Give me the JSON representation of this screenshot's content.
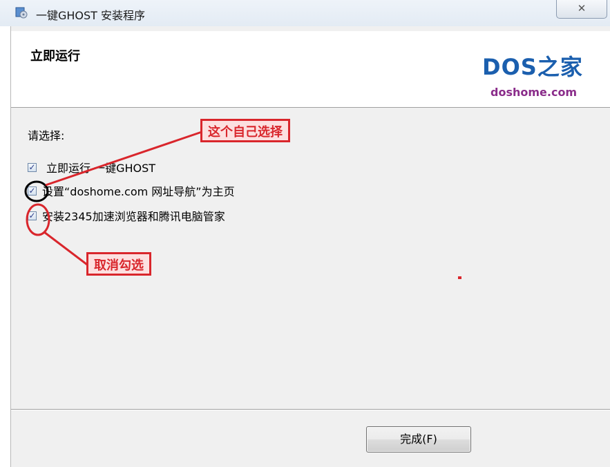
{
  "window": {
    "title": "一键GHOST 安装程序",
    "close_label": "✕"
  },
  "header": {
    "title": "立即运行",
    "logo_main": "DOS之家",
    "logo_sub": "doshome.com"
  },
  "body": {
    "prompt": "请选择:",
    "options": [
      {
        "label": "立即运行 一键GHOST",
        "checked": true
      },
      {
        "label": "设置“doshome.com 网址导航”为主页",
        "checked": true
      },
      {
        "label": "安装2345加速浏览器和腾讯电脑管家",
        "checked": true
      }
    ]
  },
  "footer": {
    "finish_label": "完成(F)"
  },
  "annotations": {
    "top_callout": "这个自己选择",
    "bottom_callout": "取消勾选",
    "color": "#d9262c"
  }
}
